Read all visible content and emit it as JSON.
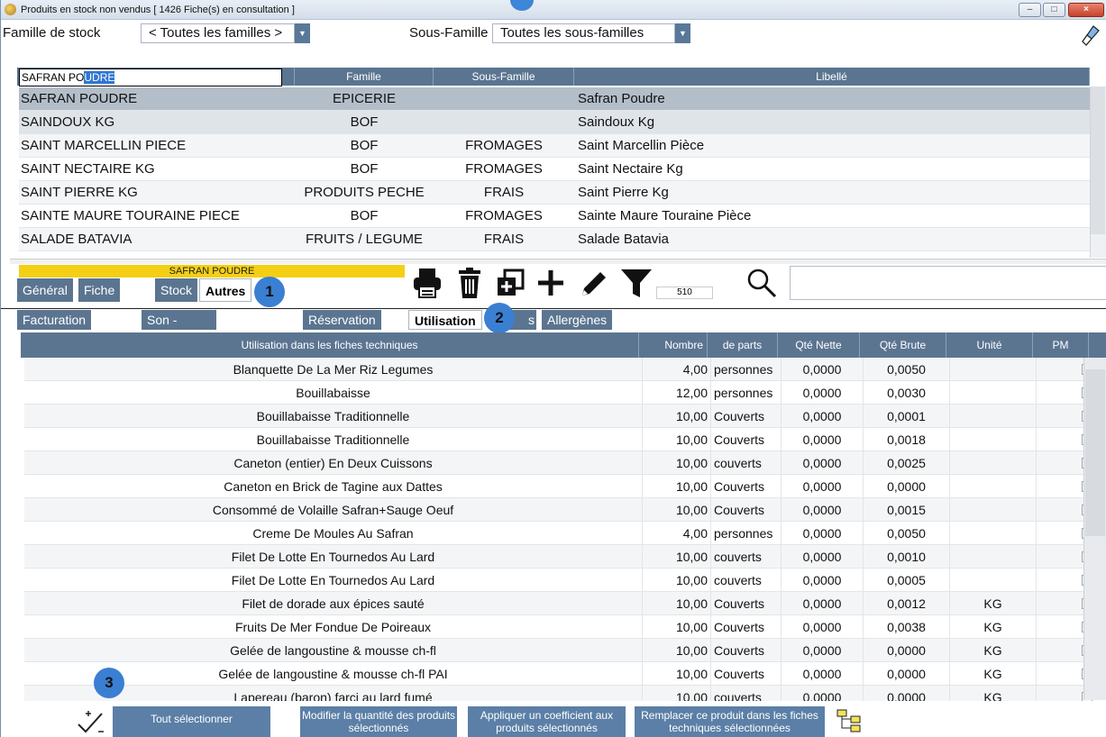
{
  "window": {
    "title": "Produits en stock non vendus  [ 1426 Fiche(s) en consultation ]",
    "min": "–",
    "max": "□",
    "close": "×"
  },
  "filters": {
    "famille_label": "Famille de stock",
    "famille_value": "< Toutes les familles >",
    "sousfamille_label": "Sous-Famille",
    "sousfamille_value": "Toutes les sous-familles"
  },
  "grid1": {
    "search_prefix": "SAFRAN PO",
    "search_selected": "UDRE",
    "headers": [
      "Famille",
      "Sous-Famille",
      "Libellé"
    ],
    "rows": [
      {
        "code": "SAFRAN POUDRE",
        "famille": "EPICERIE",
        "sous": "",
        "libelle": "Safran Poudre"
      },
      {
        "code": "SAINDOUX KG",
        "famille": "BOF",
        "sous": "",
        "libelle": "Saindoux Kg"
      },
      {
        "code": "SAINT MARCELLIN PIECE",
        "famille": "BOF",
        "sous": "FROMAGES",
        "libelle": "Saint Marcellin Pièce"
      },
      {
        "code": "SAINT NECTAIRE KG",
        "famille": "BOF",
        "sous": "FROMAGES",
        "libelle": "Saint Nectaire Kg"
      },
      {
        "code": "SAINT PIERRE KG",
        "famille": "PRODUITS PECHE",
        "sous": "FRAIS",
        "libelle": "Saint Pierre Kg"
      },
      {
        "code": "SAINTE MAURE TOURAINE PIECE",
        "famille": "BOF",
        "sous": "FROMAGES",
        "libelle": "Sainte Maure Touraine Pièce"
      },
      {
        "code": "SALADE BATAVIA",
        "famille": "FRUITS / LEGUME",
        "sous": "FRAIS",
        "libelle": "Salade Batavia"
      }
    ]
  },
  "current_product": "SAFRAN POUDRE",
  "tabs1": [
    "Général",
    "Fiche Tch.",
    "Stock",
    "Autres"
  ],
  "counter": "510",
  "badges": [
    "1",
    "2",
    "3"
  ],
  "tabs2": [
    "Facturation - DLC",
    "Son - Photos - Documents",
    "Réservation",
    "Utilisation",
    "s",
    "Allergènes"
  ],
  "grid2": {
    "headers": [
      "Utilisation dans les fiches techniques",
      "Nombre",
      "de parts",
      "Qté Nette",
      "Qté Brute",
      "Unité",
      "PM"
    ],
    "rows": [
      {
        "name": "Blanquette De La Mer Riz Legumes",
        "nombre": "4,00",
        "parts": "personnes",
        "nette": "0,0000",
        "brute": "0,0050",
        "unite": "",
        "pm": ""
      },
      {
        "name": "Bouillabaisse",
        "nombre": "12,00",
        "parts": "personnes",
        "nette": "0,0000",
        "brute": "0,0030",
        "unite": "",
        "pm": ""
      },
      {
        "name": "Bouillabaisse Traditionnelle",
        "nombre": "10,00",
        "parts": "Couverts",
        "nette": "0,0000",
        "brute": "0,0001",
        "unite": "",
        "pm": ""
      },
      {
        "name": "Bouillabaisse Traditionnelle",
        "nombre": "10,00",
        "parts": "Couverts",
        "nette": "0,0000",
        "brute": "0,0018",
        "unite": "",
        "pm": ""
      },
      {
        "name": "Caneton (entier) En Deux Cuissons",
        "nombre": "10,00",
        "parts": "couverts",
        "nette": "0,0000",
        "brute": "0,0025",
        "unite": "",
        "pm": ""
      },
      {
        "name": "Caneton en Brick de Tagine aux Dattes",
        "nombre": "10,00",
        "parts": "Couverts",
        "nette": "0,0000",
        "brute": "0,0000",
        "unite": "",
        "pm": "✔"
      },
      {
        "name": "Consommé de Volaille Safran+Sauge Oeuf",
        "nombre": "10,00",
        "parts": "Couverts",
        "nette": "0,0000",
        "brute": "0,0015",
        "unite": "",
        "pm": ""
      },
      {
        "name": "Creme De Moules Au Safran",
        "nombre": "4,00",
        "parts": "personnes",
        "nette": "0,0000",
        "brute": "0,0050",
        "unite": "",
        "pm": ""
      },
      {
        "name": "Filet De Lotte En Tournedos Au Lard",
        "nombre": "10,00",
        "parts": "couverts",
        "nette": "0,0000",
        "brute": "0,0010",
        "unite": "",
        "pm": ""
      },
      {
        "name": "Filet De Lotte En Tournedos Au Lard",
        "nombre": "10,00",
        "parts": "couverts",
        "nette": "0,0000",
        "brute": "0,0005",
        "unite": "",
        "pm": ""
      },
      {
        "name": "Filet de dorade aux épices sauté",
        "nombre": "10,00",
        "parts": "Couverts",
        "nette": "0,0000",
        "brute": "0,0012",
        "unite": "KG",
        "pm": ""
      },
      {
        "name": "Fruits De Mer Fondue De Poireaux",
        "nombre": "10,00",
        "parts": "Couverts",
        "nette": "0,0000",
        "brute": "0,0038",
        "unite": "KG",
        "pm": ""
      },
      {
        "name": "Gelée de langoustine & mousse ch-fl",
        "nombre": "10,00",
        "parts": "Couverts",
        "nette": "0,0000",
        "brute": "0,0000",
        "unite": "KG",
        "pm": "✔"
      },
      {
        "name": "Gelée de langoustine & mousse ch-fl PAI",
        "nombre": "10,00",
        "parts": "Couverts",
        "nette": "0,0000",
        "brute": "0,0000",
        "unite": "KG",
        "pm": "✔"
      },
      {
        "name": "Lapereau (baron) farci au lard fumé",
        "nombre": "10,00",
        "parts": "couverts",
        "nette": "0,0000",
        "brute": "0,0000",
        "unite": "KG",
        "pm": "✔"
      }
    ]
  },
  "bottom": {
    "tout": "Tout sélectionner",
    "modifier": "Modifier la quantité des produits sélectionnés",
    "appliquer": "Appliquer un coefficient aux produits sélectionnés",
    "remplacer": "Remplacer ce produit dans les fiches techniques sélectionnées"
  }
}
